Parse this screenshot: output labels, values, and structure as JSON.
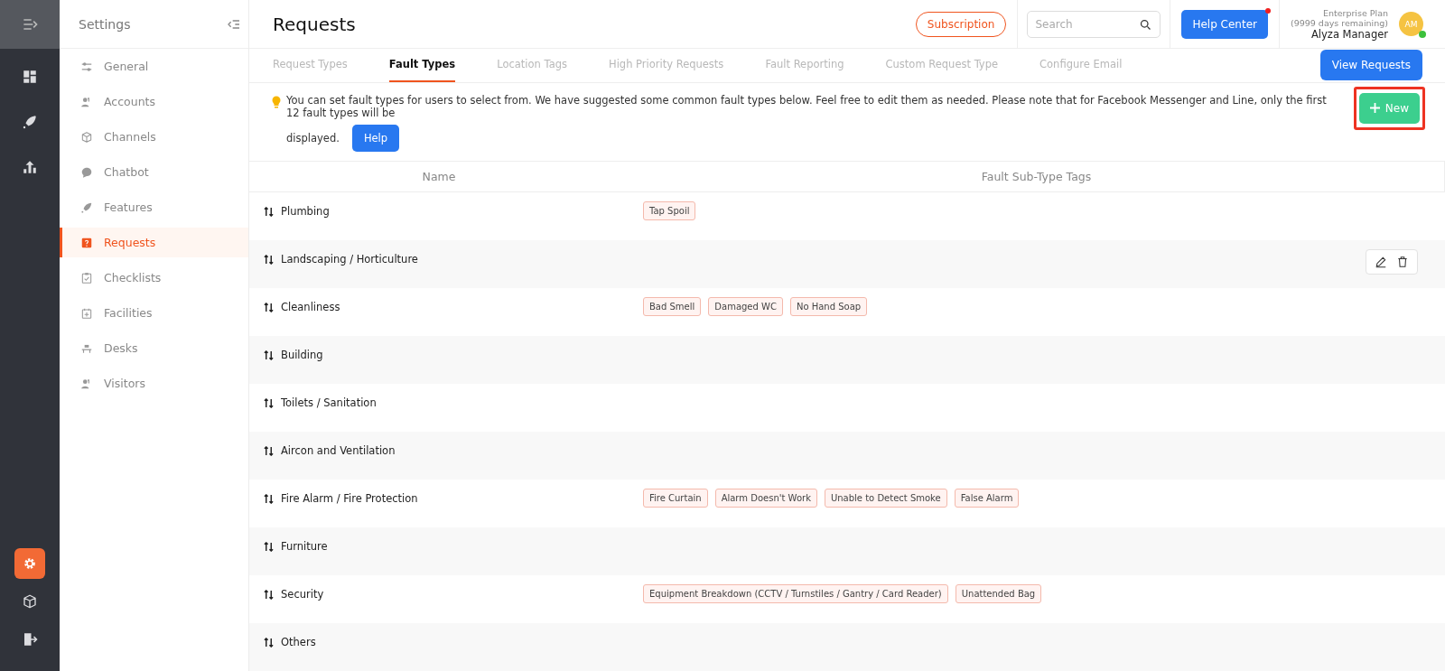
{
  "rail": {
    "items": [
      {
        "selected": false
      },
      {
        "selected": false
      },
      {
        "selected": false
      }
    ],
    "bottom_items": [
      {
        "selected": true
      },
      {
        "selected": false
      },
      {
        "selected": false
      }
    ]
  },
  "sidebar": {
    "title": "Settings",
    "items": [
      {
        "label": "General",
        "selected": false
      },
      {
        "label": "Accounts",
        "selected": false
      },
      {
        "label": "Channels",
        "selected": false
      },
      {
        "label": "Chatbot",
        "selected": false
      },
      {
        "label": "Features",
        "selected": false
      },
      {
        "label": "Requests",
        "selected": true
      },
      {
        "label": "Checklists",
        "selected": false
      },
      {
        "label": "Facilities",
        "selected": false
      },
      {
        "label": "Desks",
        "selected": false
      },
      {
        "label": "Visitors",
        "selected": false
      }
    ]
  },
  "header": {
    "title": "Requests",
    "subscription": "Subscription",
    "search": {
      "placeholder": "Search"
    },
    "help_center": {
      "label": "Help Center",
      "notification": true
    },
    "user": {
      "plan": "Enterprise Plan",
      "remaining": "(9999 days remaining)",
      "name": "Alyza Manager",
      "initials": "AM",
      "online": true
    }
  },
  "tabs": [
    {
      "label": "Request Types",
      "selected": false
    },
    {
      "label": "Fault Types",
      "selected": true
    },
    {
      "label": "Location Tags",
      "selected": false
    },
    {
      "label": "High Priority Requests",
      "selected": false
    },
    {
      "label": "Fault Reporting",
      "selected": false
    },
    {
      "label": "Custom Request Type",
      "selected": false
    },
    {
      "label": "Configure Email",
      "selected": false
    }
  ],
  "view_requests": "View Requests",
  "notice": {
    "lines": [
      "You can set fault types for users to select from. We have suggested some common fault types below. Feel free to edit them as needed. Please note that for Facebook Messenger and Line, only the first 12 fault types will be",
      "displayed."
    ],
    "help": "Help"
  },
  "new_button": {
    "label": "New",
    "highlighted": true
  },
  "table": {
    "columns": [
      "Name",
      "Fault Sub-Type Tags"
    ],
    "rows": [
      {
        "name": "Plumbing",
        "tags": [
          "Tap Spoil"
        ],
        "actions_shown": false
      },
      {
        "name": "Landscaping / Horticulture",
        "tags": [],
        "actions_shown": true
      },
      {
        "name": "Cleanliness",
        "tags": [
          "Bad Smell",
          "Damaged WC",
          "No Hand Soap"
        ],
        "actions_shown": false
      },
      {
        "name": "Building",
        "tags": [],
        "actions_shown": false
      },
      {
        "name": "Toilets / Sanitation",
        "tags": [],
        "actions_shown": false
      },
      {
        "name": "Aircon and Ventilation",
        "tags": [],
        "actions_shown": false
      },
      {
        "name": "Fire Alarm / Fire Protection",
        "tags": [
          "Fire Curtain",
          "Alarm Doesn't Work",
          "Unable to Detect Smoke",
          "False Alarm"
        ],
        "actions_shown": false
      },
      {
        "name": "Furniture",
        "tags": [],
        "actions_shown": false
      },
      {
        "name": "Security",
        "tags": [
          "Equipment Breakdown (CCTV / Turnstiles / Gantry / Card Reader)",
          "Unattended Bag"
        ],
        "actions_shown": false
      },
      {
        "name": "Others",
        "tags": [],
        "actions_shown": false
      }
    ]
  }
}
